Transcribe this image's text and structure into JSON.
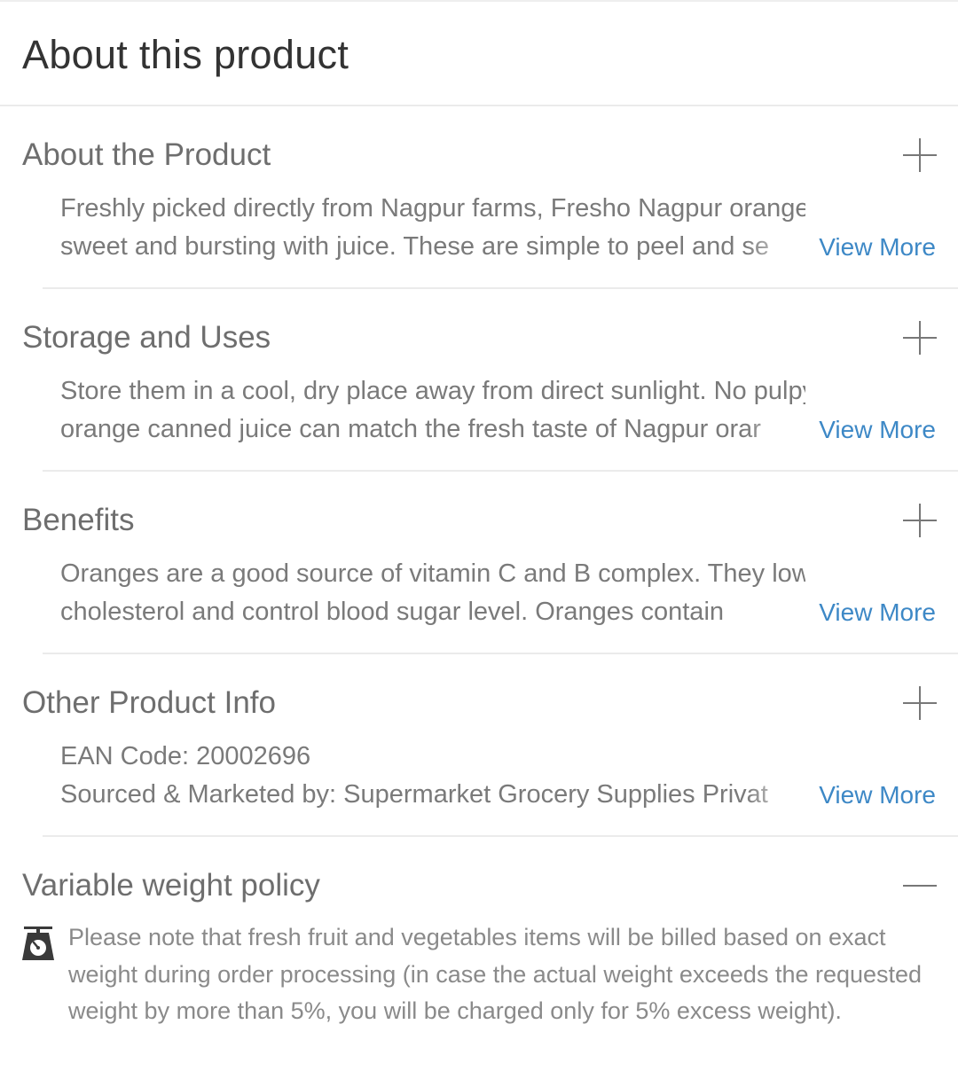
{
  "page": {
    "title": "About this product"
  },
  "sections": [
    {
      "title": "About the Product",
      "toggle_icon": "plus-icon",
      "lines": [
        "Freshly picked directly from Nagpur farms, Fresho Nagpur oranges are",
        "sweet and bursting with juice. These are simple to peel and se"
      ],
      "view_more": "View More"
    },
    {
      "title": "Storage and Uses",
      "toggle_icon": "plus-icon",
      "lines": [
        "Store them in a cool, dry place away from direct sunlight. No pulpy",
        "orange canned juice can match the fresh taste of Nagpur orar"
      ],
      "view_more": "View More"
    },
    {
      "title": "Benefits",
      "toggle_icon": "plus-icon",
      "lines": [
        "Oranges are a good source of vitamin C and B complex. They lower",
        "cholesterol and control blood sugar level. Oranges contain"
      ],
      "view_more": "View More"
    },
    {
      "title": "Other Product Info",
      "toggle_icon": "plus-icon",
      "lines": [
        "EAN Code: 20002696",
        "Sourced & Marketed by: Supermarket Grocery Supplies Privat"
      ],
      "view_more": "View More"
    }
  ],
  "policy": {
    "title": "Variable weight policy",
    "toggle_icon": "minus-icon",
    "icon": "weighing-scale-icon",
    "text": "Please note that fresh fruit and vegetables items will be billed based on exact weight during order processing (in case the actual weight exceeds the requested weight by more than 5%, you will be charged only for 5% excess weight)."
  },
  "colors": {
    "link": "#3d88c6",
    "title_text": "#333333",
    "section_title": "#6e6e6e",
    "body_text": "#7a7a7a",
    "divider": "#ebebeb"
  }
}
